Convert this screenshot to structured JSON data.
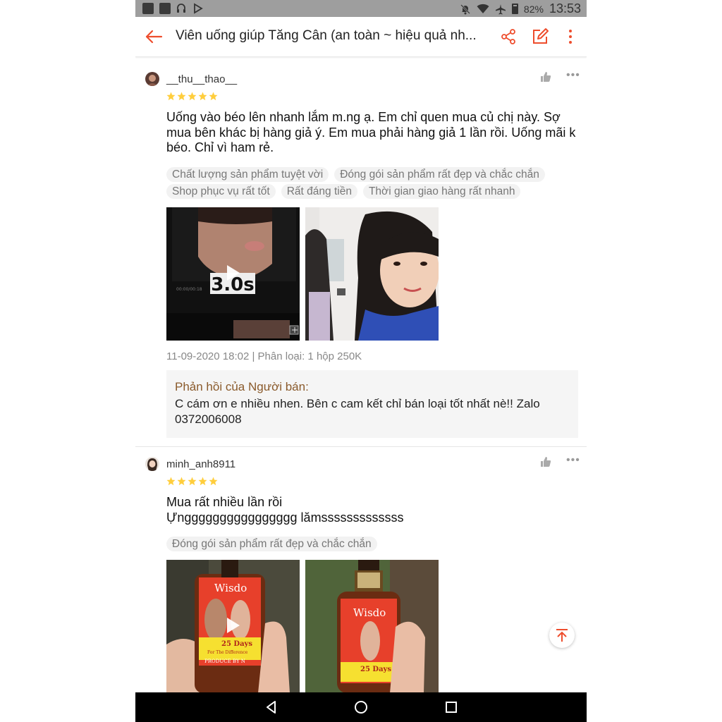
{
  "status_bar": {
    "battery_percent": "82%",
    "time": "13:53",
    "icons": [
      "app-square-icon",
      "app-square-icon",
      "headset-icon",
      "play-store-icon",
      "bell-off-icon",
      "wifi-icon",
      "airplane-icon",
      "battery-icon"
    ]
  },
  "header": {
    "title": "Viên uống giúp Tăng Cân (an toàn ~ hiệu quả nh...",
    "accent_color": "#ee4d2d",
    "icons": [
      "back-arrow-icon",
      "share-icon",
      "edit-icon",
      "more-vertical-icon"
    ]
  },
  "reviews": [
    {
      "username": "__thu__thao__",
      "rating": 5,
      "text": "Uống vào béo lên nhanh lắm m.ng ạ. Em chỉ quen mua củ chị này. Sợ mua bên khác bị hàng giả ý. Em mua phải hàng giả 1 lần rồi. Uống mãi k béo. Chỉ vì ham rẻ.",
      "tags": [
        "Chất lượng sản phẩm tuyệt vời",
        "Đóng gói sản phẩm rất đẹp và chắc chắn",
        "Shop phục vụ rất tốt",
        "Rất đáng tiền",
        "Thời gian giao hàng rất nhanh"
      ],
      "video_duration": "3.0s",
      "meta": "11-09-2020 18:02 | Phân loại: 1 hộp 250K",
      "reply_heading": "Phản hồi của Người bán:",
      "reply_text": "C cám ơn e nhiều nhen. Bên c cam kết chỉ bán loại tốt nhất nè!! Zalo 0372006008"
    },
    {
      "username": "minh_anh8911",
      "rating": 5,
      "text_line1": "Mua rất nhiều lần rồi",
      "text_line2": "Ựngggggggggggggggg lămsssssssssssss",
      "tags": [
        "Đóng gói sản phẩm rất đẹp và chắc chắn"
      ],
      "bottle_text": {
        "brand": "Wisdo",
        "days": "25 Days",
        "subtitle": "For The Difference",
        "produce": "PRODUCE BY N"
      }
    }
  ]
}
